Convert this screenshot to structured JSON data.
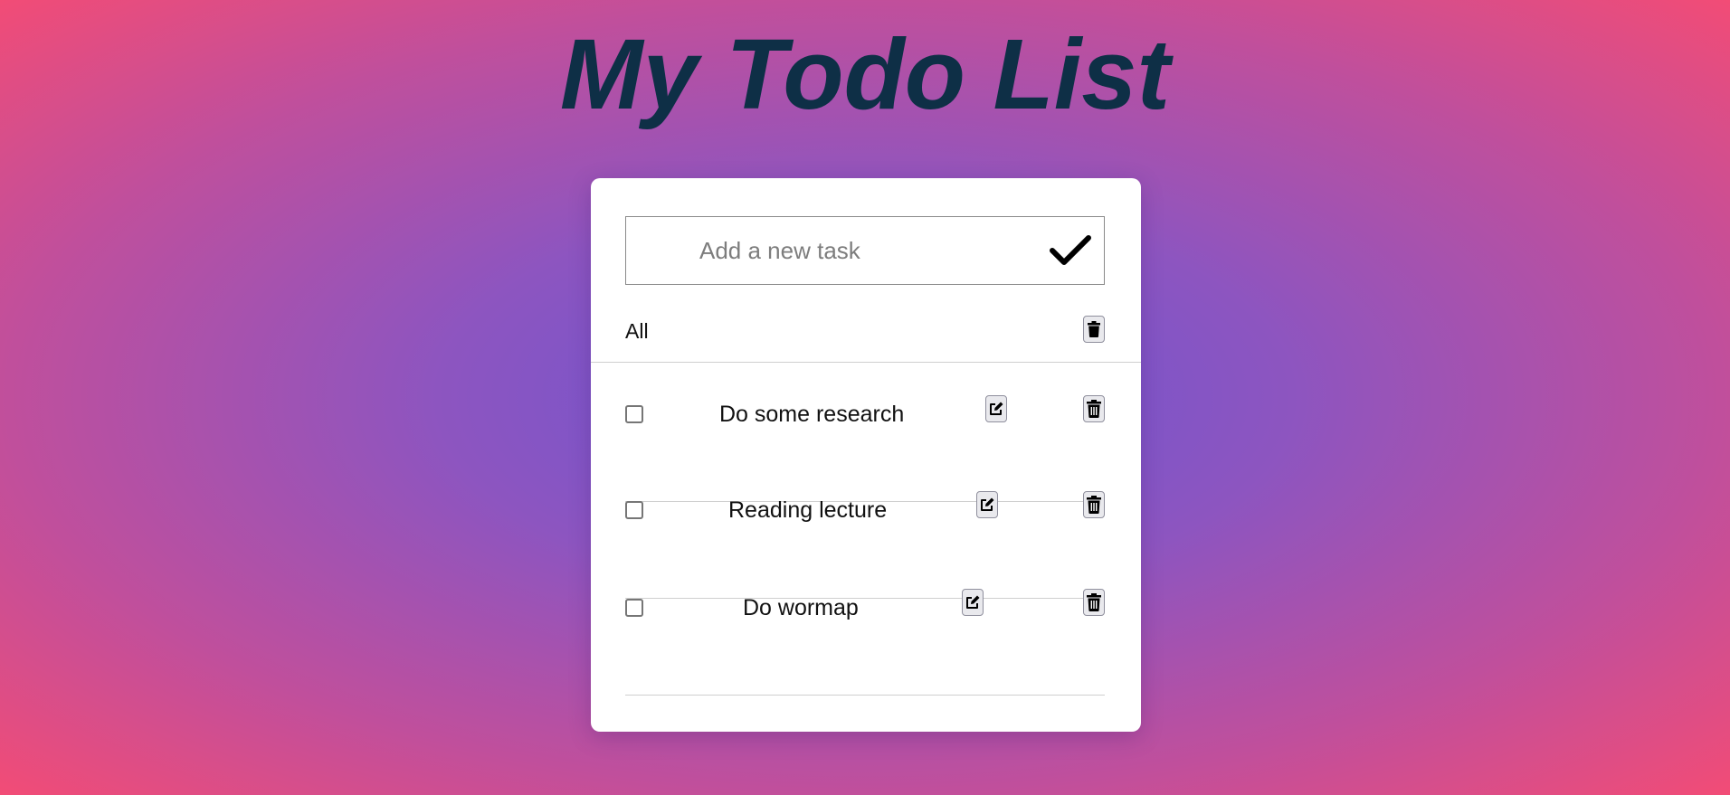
{
  "app": {
    "title": "My Todo List"
  },
  "input": {
    "placeholder": "Add a new task",
    "value": "",
    "submit_icon": "checkmark-icon"
  },
  "filter": {
    "label": "All",
    "clear_icon": "trash-icon"
  },
  "todos": [
    {
      "text": "Do some research",
      "completed": false,
      "edit_icon": "edit-icon",
      "delete_icon": "trash-icon"
    },
    {
      "text": "Reading lecture",
      "completed": false,
      "edit_icon": "edit-icon",
      "delete_icon": "trash-icon"
    },
    {
      "text": "Do wormap",
      "completed": false,
      "edit_icon": "edit-icon",
      "delete_icon": "trash-icon"
    }
  ],
  "colors": {
    "title": "#0e2f46",
    "background_center": "#6b54d2",
    "background_edge": "#f24c76",
    "card": "#ffffff"
  }
}
